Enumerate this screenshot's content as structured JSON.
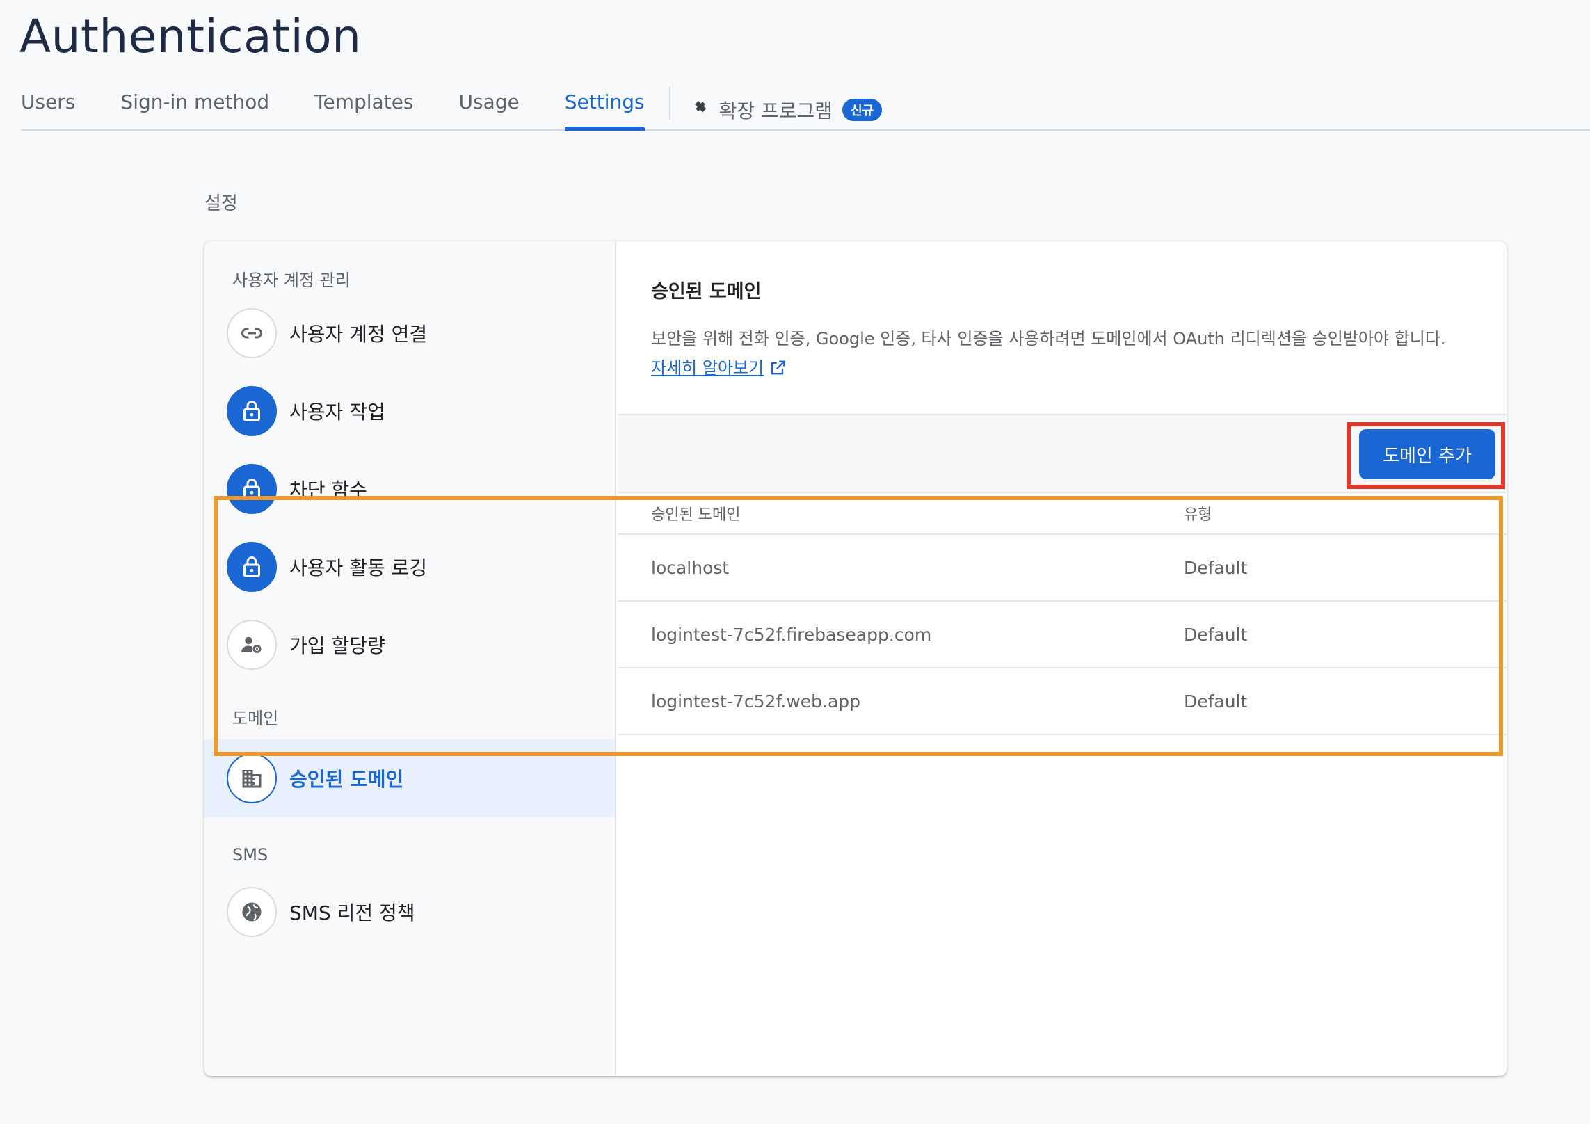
{
  "header": {
    "title": "Authentication"
  },
  "tabs": [
    {
      "label": "Users"
    },
    {
      "label": "Sign-in method"
    },
    {
      "label": "Templates"
    },
    {
      "label": "Usage"
    },
    {
      "label": "Settings"
    }
  ],
  "extensions_tab": {
    "label": "확장 프로그램",
    "badge": "신규"
  },
  "section": {
    "label": "설정"
  },
  "sidebar": {
    "groups": [
      {
        "title": "사용자 계정 관리",
        "items": [
          {
            "label": "사용자 계정 연결",
            "icon": "link-icon"
          },
          {
            "label": "사용자 작업",
            "icon": "lock-icon"
          },
          {
            "label": "차단 함수",
            "icon": "lock-icon"
          },
          {
            "label": "사용자 활동 로깅",
            "icon": "lock-icon"
          },
          {
            "label": "가입 할당량",
            "icon": "user-settings-icon"
          }
        ]
      },
      {
        "title": "도메인",
        "items": [
          {
            "label": "승인된 도메인",
            "icon": "building-icon",
            "active": true
          }
        ]
      },
      {
        "title": "SMS",
        "items": [
          {
            "label": "SMS 리전 정책",
            "icon": "globe-icon"
          }
        ]
      }
    ]
  },
  "main": {
    "title": "승인된 도메인",
    "description": "보안을 위해 전화 인증, Google 인증, 타사 인증을 사용하려면 도메인에서 OAuth 리디렉션을 승인받아야 합니다.",
    "learn_more": "자세히 알아보기",
    "add_button": "도메인 추가",
    "table": {
      "headers": [
        "승인된 도메인",
        "유형"
      ],
      "rows": [
        [
          "localhost",
          "Default"
        ],
        [
          "logintest-7c52f.firebaseapp.com",
          "Default"
        ],
        [
          "logintest-7c52f.web.app",
          "Default"
        ]
      ]
    }
  },
  "colors": {
    "accent": "#1a66d2",
    "highlight_red": "#e2382c",
    "highlight_orange": "#f0972e"
  }
}
